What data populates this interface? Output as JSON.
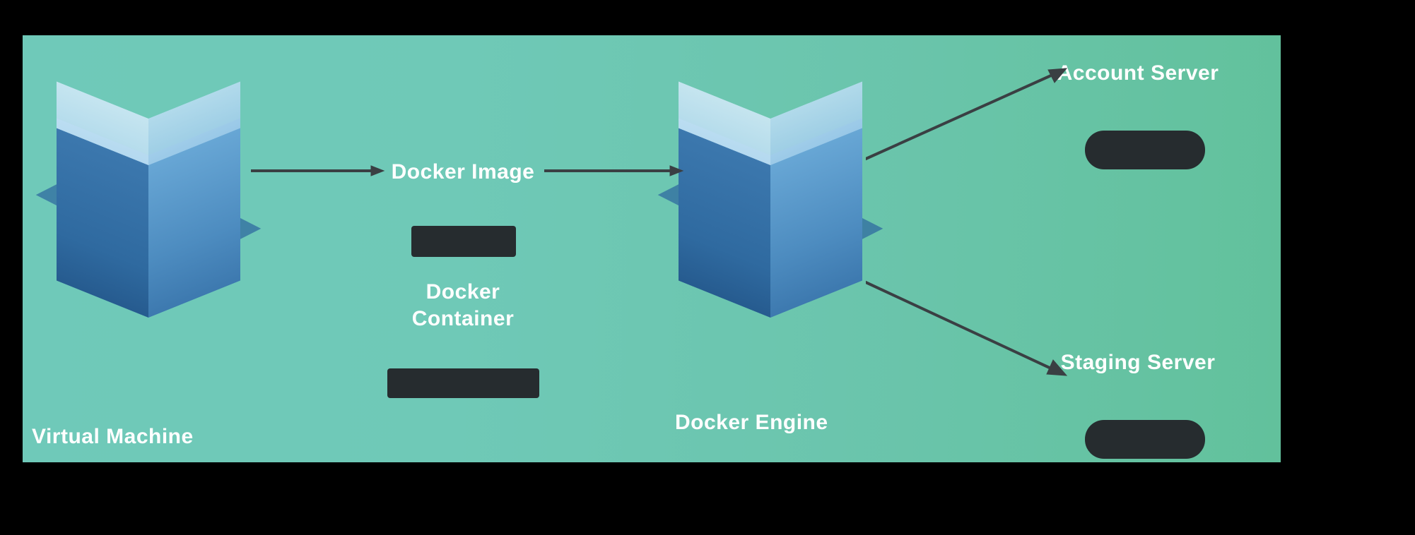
{
  "labels": {
    "virtual_machine": "Virtual Machine",
    "docker_engine": "Docker Engine",
    "docker_image": "Docker Image",
    "docker_container": "Docker Container",
    "account_server": "Account Server",
    "staging_server": "Staging Server"
  }
}
